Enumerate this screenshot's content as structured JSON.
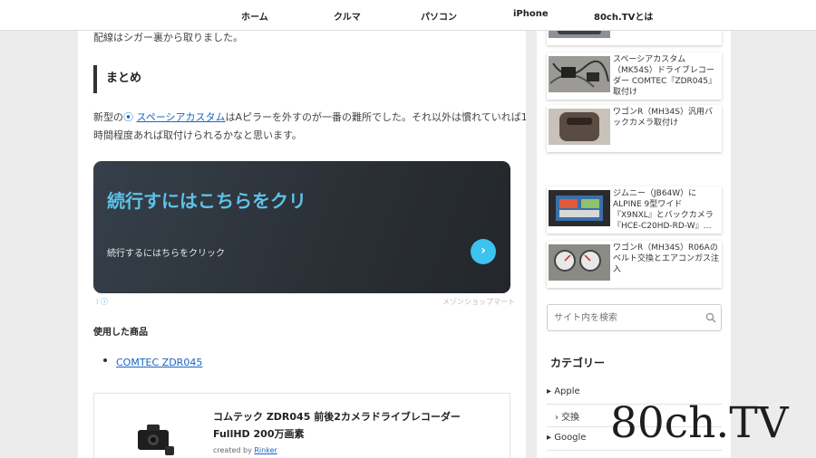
{
  "nav": {
    "items": [
      "ホーム",
      "クルマ",
      "パソコン",
      "iPhone",
      "80ch.TVとは"
    ]
  },
  "article": {
    "top_text": "配線はシガー裏から取りました。",
    "heading": "まとめ",
    "para_prefix": "新型の",
    "para_link": "スペーシアカスタム",
    "para_line1_rest": "はAピラーを外すのが一番の難所でした。それ以外は慣れていれば1",
    "para_line2": "時間程度あれば取付けられるかなと思います。",
    "ad": {
      "headline": "続行すにはこちらをクリ",
      "sub": "続行するにはちらをクリック",
      "button": "›",
      "info": "⁝ ⓘ",
      "source": "メゾンショップマート"
    },
    "used_label": "使用した商品",
    "list_item": "COMTEC ZDR045",
    "product": {
      "title": "コムテック ZDR045 前後2カメラドライブレコーダー FullHD 200万画素",
      "created_by_prefix": "created by ",
      "created_by_name": "Rinker"
    }
  },
  "sidebar": {
    "cards": [
      {
        "text": ""
      },
      {
        "text": "スペーシアカスタム（MK54S）ドライブレコーダー COMTEC『ZDR045』取付け"
      },
      {
        "text": "ワゴンR（MH34S）汎用バックカメラ取付け"
      },
      {
        "text": "ジムニー（JB64W）にALPINE 9型ワイド『X9NXL』とバックカメラ『HCE-C20HD-RD-W』…"
      },
      {
        "text": "ワゴンR（MH34S）R06Aのベルト交換とエアコンガス注入"
      }
    ],
    "search_placeholder": "サイト内を検索",
    "category_heading": "カテゴリー",
    "categories": [
      {
        "label": "▸ Apple"
      },
      {
        "label": "› 交換"
      },
      {
        "label": "▸ Google"
      }
    ]
  },
  "watermark": "80ch.TV"
}
